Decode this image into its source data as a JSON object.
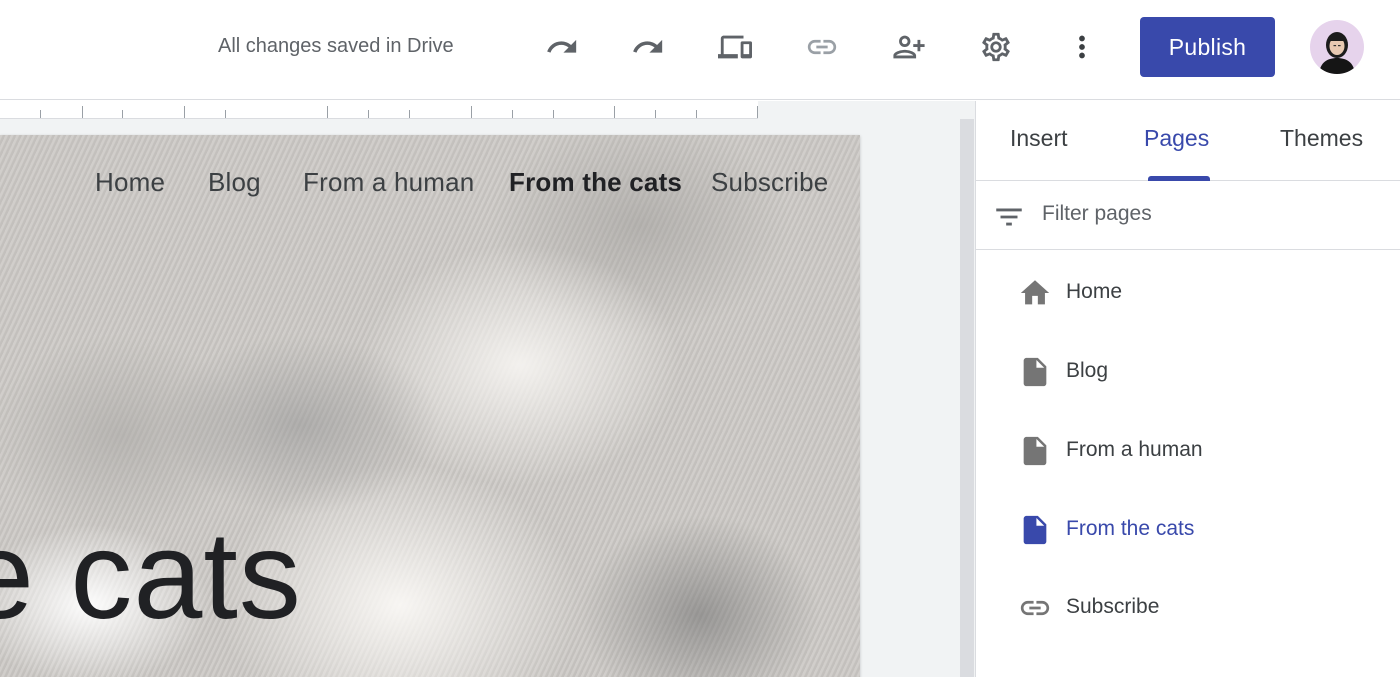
{
  "colors": {
    "accent": "#3949ab",
    "icon_gray": "#5f6368",
    "page_icon_gray": "#757575",
    "text_dark": "#202124"
  },
  "toolbar": {
    "save_status": "All changes saved in Drive",
    "icons": [
      "undo-icon",
      "redo-icon",
      "preview-devices-icon",
      "link-icon",
      "share-icon",
      "settings-icon",
      "more-vert-icon"
    ],
    "publish_label": "Publish"
  },
  "site": {
    "nav": [
      {
        "label": "Home",
        "active": false
      },
      {
        "label": "Blog",
        "active": false
      },
      {
        "label": "From a human",
        "active": false
      },
      {
        "label": "From the cats",
        "active": true
      },
      {
        "label": "Subscribe",
        "active": false
      }
    ],
    "hero_title": "e cats"
  },
  "panel": {
    "tabs": [
      {
        "label": "Insert",
        "active": false
      },
      {
        "label": "Pages",
        "active": true
      },
      {
        "label": "Themes",
        "active": false
      }
    ],
    "filter_placeholder": "Filter pages",
    "pages": [
      {
        "label": "Home",
        "icon": "home-icon",
        "active": false
      },
      {
        "label": "Blog",
        "icon": "page-icon",
        "active": false
      },
      {
        "label": "From a human",
        "icon": "page-icon",
        "active": false
      },
      {
        "label": "From the cats",
        "icon": "page-icon",
        "active": true
      },
      {
        "label": "Subscribe",
        "icon": "link-icon",
        "active": false
      }
    ]
  }
}
